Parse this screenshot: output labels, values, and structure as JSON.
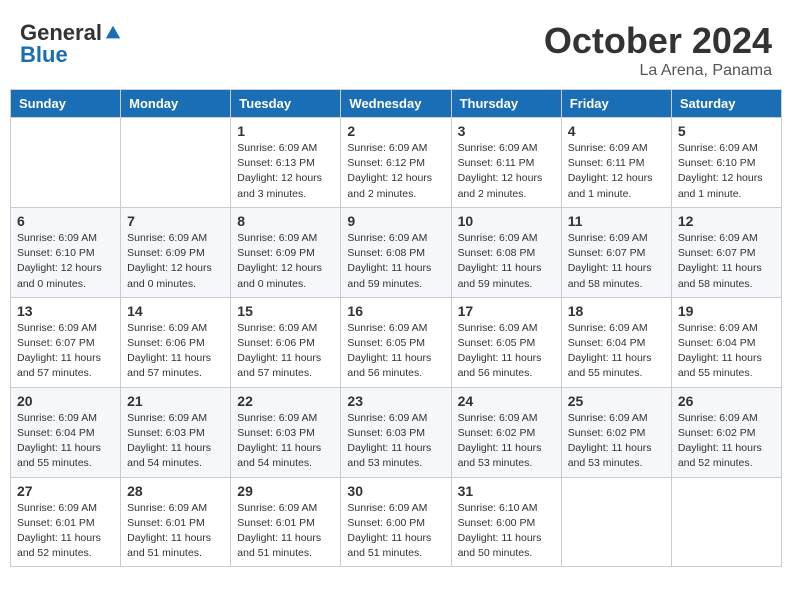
{
  "header": {
    "logo_general": "General",
    "logo_blue": "Blue",
    "month_title": "October 2024",
    "subtitle": "La Arena, Panama"
  },
  "days_of_week": [
    "Sunday",
    "Monday",
    "Tuesday",
    "Wednesday",
    "Thursday",
    "Friday",
    "Saturday"
  ],
  "weeks": [
    [
      {
        "day": "",
        "info": ""
      },
      {
        "day": "",
        "info": ""
      },
      {
        "day": "1",
        "info": "Sunrise: 6:09 AM\nSunset: 6:13 PM\nDaylight: 12 hours and 3 minutes."
      },
      {
        "day": "2",
        "info": "Sunrise: 6:09 AM\nSunset: 6:12 PM\nDaylight: 12 hours and 2 minutes."
      },
      {
        "day": "3",
        "info": "Sunrise: 6:09 AM\nSunset: 6:11 PM\nDaylight: 12 hours and 2 minutes."
      },
      {
        "day": "4",
        "info": "Sunrise: 6:09 AM\nSunset: 6:11 PM\nDaylight: 12 hours and 1 minute."
      },
      {
        "day": "5",
        "info": "Sunrise: 6:09 AM\nSunset: 6:10 PM\nDaylight: 12 hours and 1 minute."
      }
    ],
    [
      {
        "day": "6",
        "info": "Sunrise: 6:09 AM\nSunset: 6:10 PM\nDaylight: 12 hours and 0 minutes."
      },
      {
        "day": "7",
        "info": "Sunrise: 6:09 AM\nSunset: 6:09 PM\nDaylight: 12 hours and 0 minutes."
      },
      {
        "day": "8",
        "info": "Sunrise: 6:09 AM\nSunset: 6:09 PM\nDaylight: 12 hours and 0 minutes."
      },
      {
        "day": "9",
        "info": "Sunrise: 6:09 AM\nSunset: 6:08 PM\nDaylight: 11 hours and 59 minutes."
      },
      {
        "day": "10",
        "info": "Sunrise: 6:09 AM\nSunset: 6:08 PM\nDaylight: 11 hours and 59 minutes."
      },
      {
        "day": "11",
        "info": "Sunrise: 6:09 AM\nSunset: 6:07 PM\nDaylight: 11 hours and 58 minutes."
      },
      {
        "day": "12",
        "info": "Sunrise: 6:09 AM\nSunset: 6:07 PM\nDaylight: 11 hours and 58 minutes."
      }
    ],
    [
      {
        "day": "13",
        "info": "Sunrise: 6:09 AM\nSunset: 6:07 PM\nDaylight: 11 hours and 57 minutes."
      },
      {
        "day": "14",
        "info": "Sunrise: 6:09 AM\nSunset: 6:06 PM\nDaylight: 11 hours and 57 minutes."
      },
      {
        "day": "15",
        "info": "Sunrise: 6:09 AM\nSunset: 6:06 PM\nDaylight: 11 hours and 57 minutes."
      },
      {
        "day": "16",
        "info": "Sunrise: 6:09 AM\nSunset: 6:05 PM\nDaylight: 11 hours and 56 minutes."
      },
      {
        "day": "17",
        "info": "Sunrise: 6:09 AM\nSunset: 6:05 PM\nDaylight: 11 hours and 56 minutes."
      },
      {
        "day": "18",
        "info": "Sunrise: 6:09 AM\nSunset: 6:04 PM\nDaylight: 11 hours and 55 minutes."
      },
      {
        "day": "19",
        "info": "Sunrise: 6:09 AM\nSunset: 6:04 PM\nDaylight: 11 hours and 55 minutes."
      }
    ],
    [
      {
        "day": "20",
        "info": "Sunrise: 6:09 AM\nSunset: 6:04 PM\nDaylight: 11 hours and 55 minutes."
      },
      {
        "day": "21",
        "info": "Sunrise: 6:09 AM\nSunset: 6:03 PM\nDaylight: 11 hours and 54 minutes."
      },
      {
        "day": "22",
        "info": "Sunrise: 6:09 AM\nSunset: 6:03 PM\nDaylight: 11 hours and 54 minutes."
      },
      {
        "day": "23",
        "info": "Sunrise: 6:09 AM\nSunset: 6:03 PM\nDaylight: 11 hours and 53 minutes."
      },
      {
        "day": "24",
        "info": "Sunrise: 6:09 AM\nSunset: 6:02 PM\nDaylight: 11 hours and 53 minutes."
      },
      {
        "day": "25",
        "info": "Sunrise: 6:09 AM\nSunset: 6:02 PM\nDaylight: 11 hours and 53 minutes."
      },
      {
        "day": "26",
        "info": "Sunrise: 6:09 AM\nSunset: 6:02 PM\nDaylight: 11 hours and 52 minutes."
      }
    ],
    [
      {
        "day": "27",
        "info": "Sunrise: 6:09 AM\nSunset: 6:01 PM\nDaylight: 11 hours and 52 minutes."
      },
      {
        "day": "28",
        "info": "Sunrise: 6:09 AM\nSunset: 6:01 PM\nDaylight: 11 hours and 51 minutes."
      },
      {
        "day": "29",
        "info": "Sunrise: 6:09 AM\nSunset: 6:01 PM\nDaylight: 11 hours and 51 minutes."
      },
      {
        "day": "30",
        "info": "Sunrise: 6:09 AM\nSunset: 6:00 PM\nDaylight: 11 hours and 51 minutes."
      },
      {
        "day": "31",
        "info": "Sunrise: 6:10 AM\nSunset: 6:00 PM\nDaylight: 11 hours and 50 minutes."
      },
      {
        "day": "",
        "info": ""
      },
      {
        "day": "",
        "info": ""
      }
    ]
  ]
}
